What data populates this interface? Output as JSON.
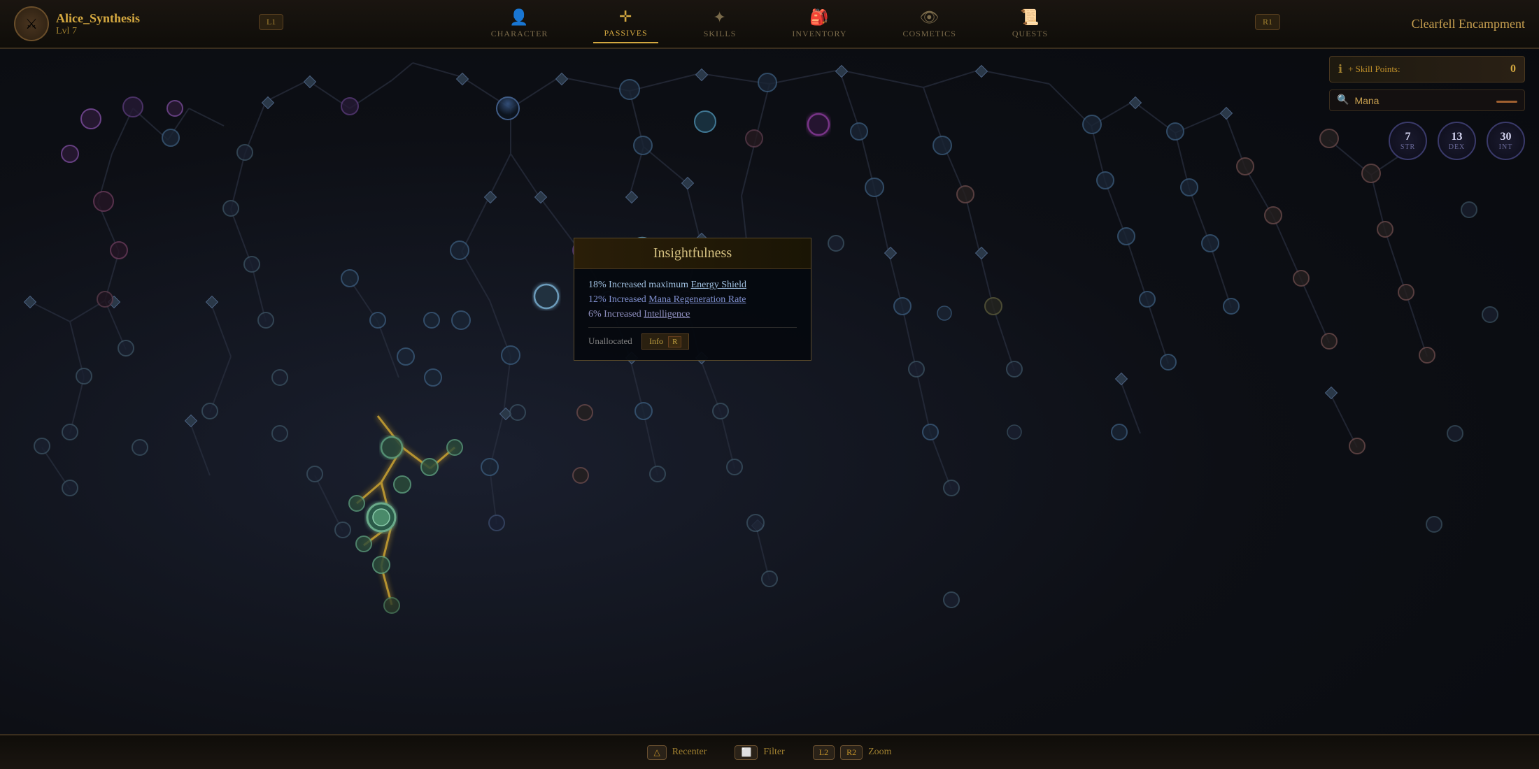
{
  "player": {
    "name": "Alice_Synthesis",
    "level_label": "Lvl 7",
    "avatar_icon": "⚔"
  },
  "location": "Clearfell Encampment",
  "nav": {
    "tabs": [
      {
        "id": "character",
        "label": "Character",
        "icon": "👤",
        "active": false
      },
      {
        "id": "passives",
        "label": "Passives",
        "icon": "✛",
        "active": true
      },
      {
        "id": "skills",
        "label": "Skills",
        "icon": "✦",
        "active": false
      },
      {
        "id": "inventory",
        "label": "Inventory",
        "icon": "🎒",
        "active": false
      },
      {
        "id": "cosmetics",
        "label": "Cosmetics",
        "icon": "👁",
        "active": false
      },
      {
        "id": "quests",
        "label": "Quests",
        "icon": "📜",
        "active": false
      }
    ]
  },
  "right_panel": {
    "info_icon": "ℹ",
    "skill_points_label": "+ Skill Points:",
    "skill_points_value": "0",
    "search_icon": "🔍",
    "search_placeholder": "Mana",
    "search_value": "Mana",
    "stats": [
      {
        "id": "str",
        "label": "STR",
        "value": "7"
      },
      {
        "id": "dex",
        "label": "DEX",
        "value": "13"
      },
      {
        "id": "int",
        "label": "INT",
        "value": "30"
      }
    ]
  },
  "tooltip": {
    "title": "Insightfulness",
    "stats": [
      {
        "text": "18% Increased maximum Energy Shield",
        "class": "energy-shield"
      },
      {
        "text": "12% Increased Mana Regeneration Rate",
        "class": "mana"
      },
      {
        "text": "6% Increased Intelligence",
        "class": "intel"
      }
    ],
    "status": "Unallocated",
    "info_label": "Info",
    "info_key": "R"
  },
  "bottom_bar": {
    "actions": [
      {
        "id": "recenter",
        "key": "△",
        "label": "Recenter"
      },
      {
        "id": "filter",
        "key": "⬜",
        "label": "Filter"
      },
      {
        "id": "zoom_l",
        "key": "L2",
        "label": ""
      },
      {
        "id": "zoom_r",
        "key": "R2",
        "label": "Zoom"
      }
    ]
  },
  "trigger_buttons": {
    "l1": "L1",
    "r1": "R1"
  }
}
